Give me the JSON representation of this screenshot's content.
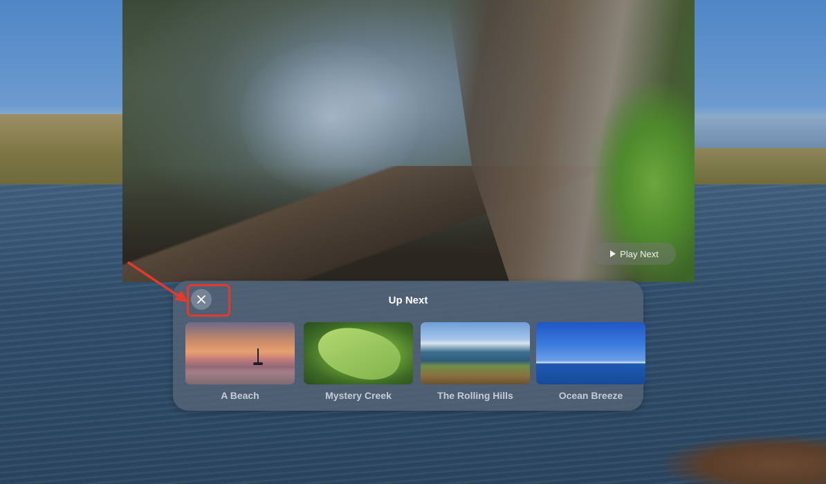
{
  "video": {
    "play_next_label": "Play Next",
    "play_icon": "play-icon"
  },
  "up_next_panel": {
    "title": "Up Next",
    "close_icon": "close-icon",
    "items": [
      {
        "title": "A Beach"
      },
      {
        "title": "Mystery Creek"
      },
      {
        "title": "The Rolling Hills"
      },
      {
        "title": "Ocean Breeze"
      }
    ]
  },
  "annotation": {
    "highlight_color": "#e6392b"
  }
}
